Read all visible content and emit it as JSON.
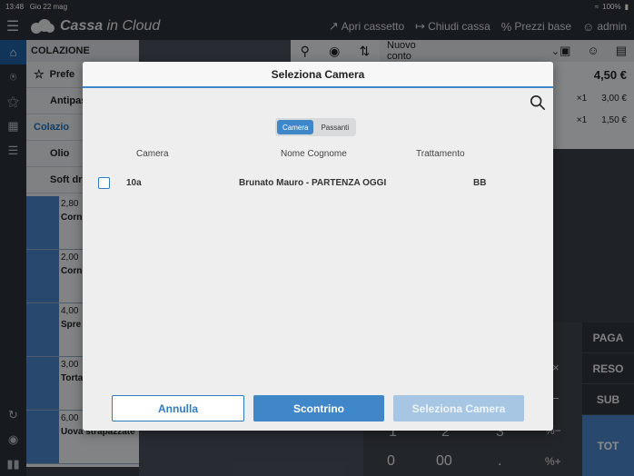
{
  "status": {
    "time": "13:48",
    "date": "Gio 22 mag",
    "battery": "100%"
  },
  "app": {
    "brand_bold": "Cassa",
    "brand_rest": " in Cloud",
    "actions": [
      {
        "label": "Apri cassetto",
        "icon": "open-drawer-icon"
      },
      {
        "label": "Chiudi cassa",
        "icon": "close-register-icon"
      },
      {
        "label": "Prezzi base",
        "icon": "percent-icon"
      },
      {
        "label": "admin",
        "icon": "user-icon"
      }
    ]
  },
  "categories": {
    "header": "COLAZIONE",
    "items": [
      "Prefe",
      "Antipas",
      "Colazio",
      "Olio",
      "Soft drin"
    ]
  },
  "products": [
    {
      "price": "2,80",
      "name": "Corn"
    },
    {
      "price": "2,00",
      "name": "Corn mign pista"
    },
    {
      "price": "4,00",
      "name": "Spre aran"
    },
    {
      "price": "3,00",
      "name": "Torta"
    },
    {
      "price": "6,00",
      "name": "Uova strapazzate"
    }
  ],
  "bill": {
    "title": "Nuovo conto",
    "total": "4,50 €",
    "lines": [
      {
        "qty": "×1",
        "price": "3,00 €"
      },
      {
        "qty": "×1",
        "price": "1,50 €"
      }
    ]
  },
  "keypad": {
    "pay": "PAGA",
    "refund": "RESO",
    "subtotal": "SUB",
    "total": "TOT",
    "keys": [
      "1",
      "2",
      "3",
      "0",
      "00",
      "."
    ],
    "ops": [
      "×",
      "−",
      "%−",
      "%+"
    ]
  },
  "modal": {
    "title": "Seleziona Camera",
    "tabs": [
      {
        "label": "Camera",
        "active": true
      },
      {
        "label": "Passanti",
        "active": false
      }
    ],
    "columns": {
      "room": "Camera",
      "name": "Nome Cognome",
      "treatment": "Trattamento"
    },
    "rows": [
      {
        "room": "10a",
        "name": "Brunato Mauro - PARTENZA OGGI",
        "treatment": "BB",
        "checked": false
      }
    ],
    "buttons": {
      "cancel": "Annulla",
      "receipt": "Scontrino",
      "select": "Seleziona Camera"
    }
  },
  "colors": {
    "accent": "#3f87c8",
    "dark": "#2b3038"
  }
}
